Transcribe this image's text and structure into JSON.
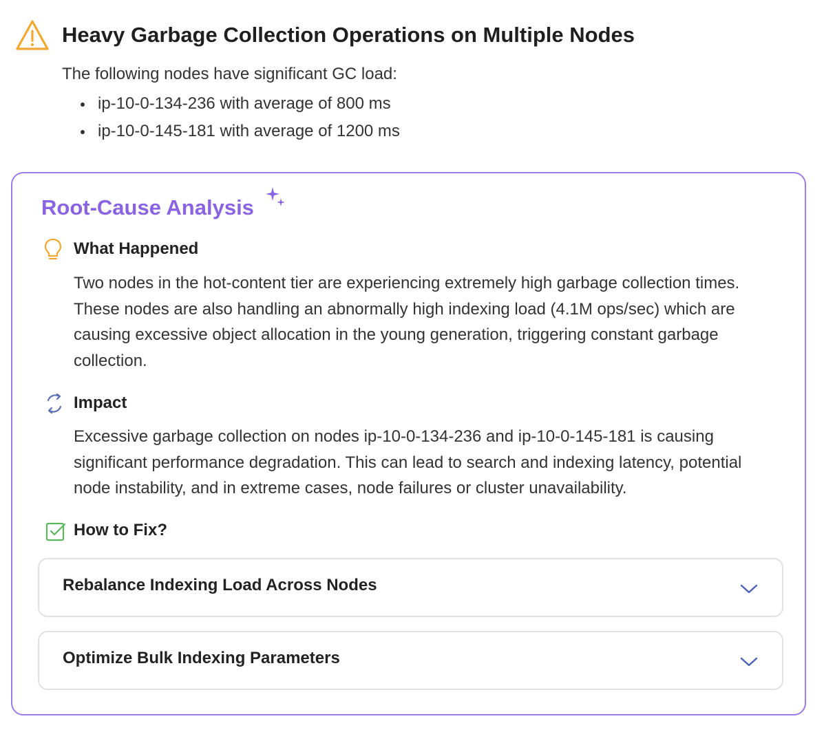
{
  "alert": {
    "icon": "warning-triangle-icon",
    "title": "Heavy Garbage Collection Operations on Multiple Nodes",
    "description": "The following nodes have significant GC load:",
    "nodes": [
      "ip-10-0-134-236 with average of 800 ms",
      "ip-10-0-145-181 with average of 1200 ms"
    ]
  },
  "rca": {
    "title": "Root-Cause Analysis",
    "accent_color": "#8a63e0",
    "border_color": "#9b7be6",
    "sections": {
      "what_happened": {
        "icon": "lightbulb-icon",
        "heading": "What Happened",
        "body": "Two nodes in the hot-content tier are experiencing extremely high garbage collection times. These nodes are also handling an abnormally high indexing load (4.1M ops/sec) which are causing excessive object allocation in the young generation, triggering constant garbage collection."
      },
      "impact": {
        "icon": "refresh-cycle-icon",
        "heading": "Impact",
        "body": "Excessive garbage collection on nodes ip-10-0-134-236 and ip-10-0-145-181 is causing significant performance degradation. This can lead to search and indexing latency, potential node instability, and in extreme cases, node failures or cluster unavailability."
      },
      "how_to_fix": {
        "icon": "checkbox-icon",
        "heading": "How to Fix?",
        "items": [
          {
            "label": "Rebalance Indexing Load Across Nodes",
            "icon": "chevron-down-icon"
          },
          {
            "label": "Optimize Bulk Indexing Parameters",
            "icon": "chevron-down-icon"
          }
        ]
      }
    }
  },
  "colors": {
    "warning": "#f0a830",
    "lightbulb": "#f0a830",
    "impact_icon": "#5b6fb0",
    "check_icon": "#5cb85c",
    "chevron": "#4a63b8"
  }
}
